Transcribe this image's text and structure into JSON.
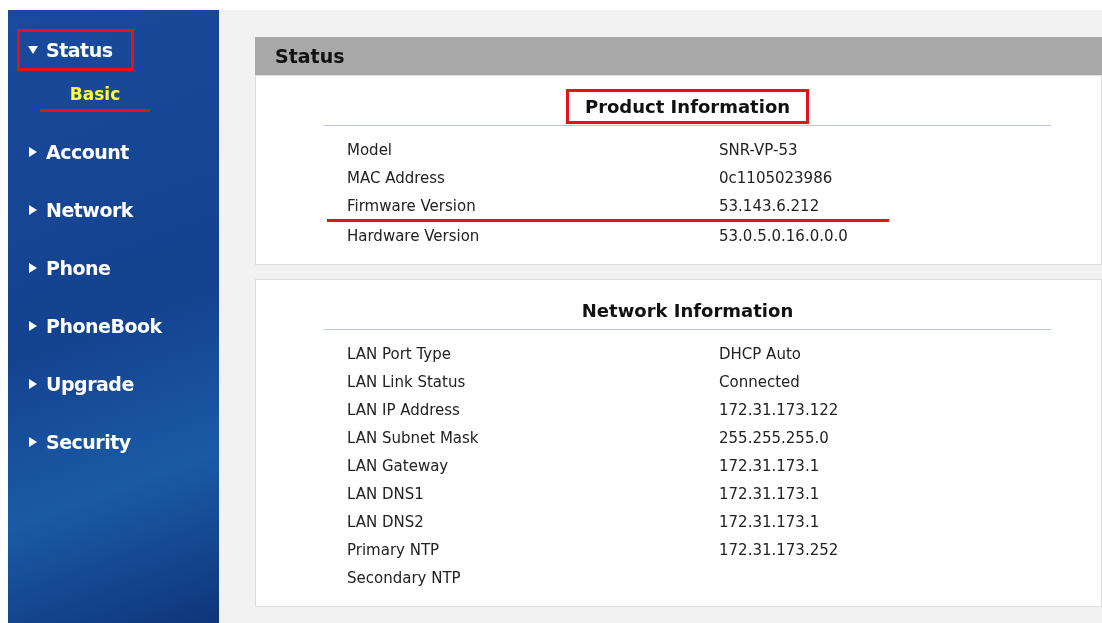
{
  "sidebar": {
    "items": [
      {
        "label": "Status",
        "expanded": true,
        "annotated": true,
        "children": [
          {
            "label": "Basic",
            "selected": true,
            "annotated": true
          }
        ]
      },
      {
        "label": "Account",
        "expanded": false,
        "annotated": false
      },
      {
        "label": "Network",
        "expanded": false,
        "annotated": false
      },
      {
        "label": "Phone",
        "expanded": false,
        "annotated": false
      },
      {
        "label": "PhoneBook",
        "expanded": false,
        "annotated": false
      },
      {
        "label": "Upgrade",
        "expanded": false,
        "annotated": false
      },
      {
        "label": "Security",
        "expanded": false,
        "annotated": false
      }
    ]
  },
  "page_title": "Status",
  "sections": [
    {
      "title": "Product Information",
      "annotated": true,
      "rows": [
        {
          "label": "Model",
          "value": "SNR-VP-53",
          "annotated": false
        },
        {
          "label": "MAC Address",
          "value": "0c1105023986",
          "annotated": false
        },
        {
          "label": "Firmware Version",
          "value": "53.143.6.212",
          "annotated": true
        },
        {
          "label": "Hardware Version",
          "value": "53.0.5.0.16.0.0.0",
          "annotated": false
        }
      ]
    },
    {
      "title": "Network Information",
      "annotated": false,
      "rows": [
        {
          "label": "LAN Port Type",
          "value": "DHCP Auto",
          "annotated": false
        },
        {
          "label": "LAN Link Status",
          "value": "Connected",
          "annotated": false
        },
        {
          "label": "LAN IP Address",
          "value": "172.31.173.122",
          "annotated": false
        },
        {
          "label": "LAN Subnet Mask",
          "value": "255.255.255.0",
          "annotated": false
        },
        {
          "label": "LAN Gateway",
          "value": "172.31.173.1",
          "annotated": false
        },
        {
          "label": "LAN DNS1",
          "value": "172.31.173.1",
          "annotated": false
        },
        {
          "label": "LAN DNS2",
          "value": "172.31.173.1",
          "annotated": false
        },
        {
          "label": "Primary NTP",
          "value": "172.31.173.252",
          "annotated": false
        },
        {
          "label": "Secondary NTP",
          "annotated": false
        }
      ]
    }
  ]
}
